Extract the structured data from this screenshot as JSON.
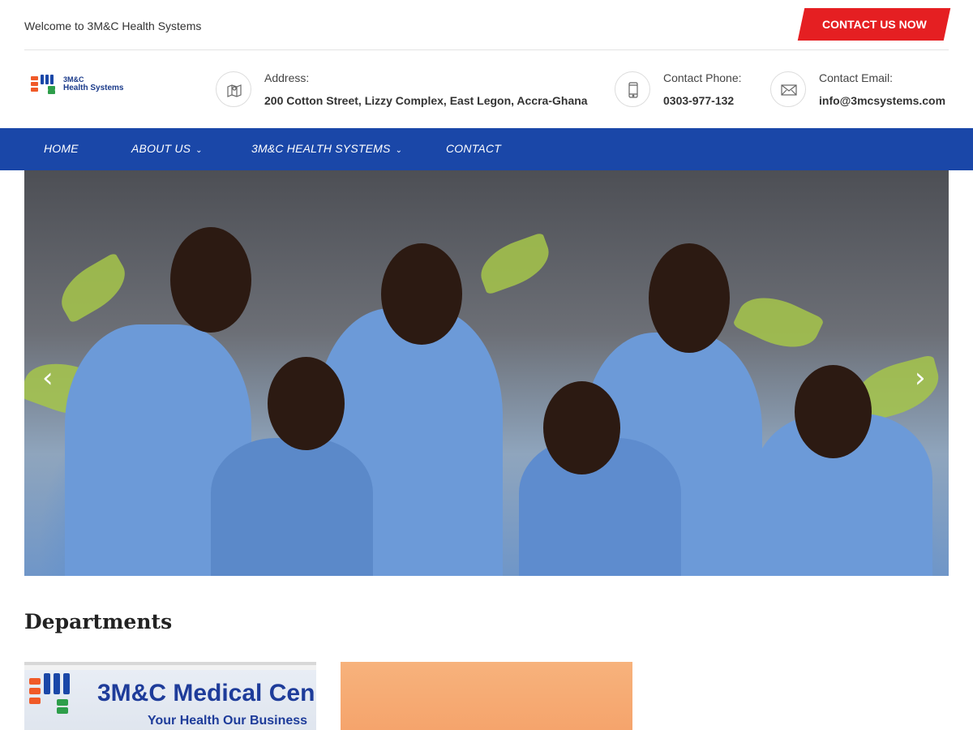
{
  "topbar": {
    "welcome": "Welcome to 3M&C Health Systems",
    "cta_label": "CONTACT US NOW"
  },
  "logo": {
    "line1": "3M&C",
    "line2": "Health Systems"
  },
  "contact_info": {
    "address_label": "Address:",
    "address_value": "200 Cotton Street, Lizzy Complex, East Legon, Accra-Ghana",
    "phone_label": "Contact Phone:",
    "phone_value": "0303-977-132",
    "email_label": "Contact Email:",
    "email_value": "info@3mcsystems.com"
  },
  "nav": {
    "items": [
      {
        "label": "HOME",
        "has_dropdown": false
      },
      {
        "label": "ABOUT US",
        "has_dropdown": true
      },
      {
        "label": "3M&C HEALTH SYSTEMS",
        "has_dropdown": true
      },
      {
        "label": "CONTACT",
        "has_dropdown": false
      }
    ]
  },
  "hero": {
    "prev_icon": "chevron-left-icon",
    "next_icon": "chevron-right-icon"
  },
  "departments": {
    "title": "Departments",
    "card1_sign_title": "3M&C Medical Cen",
    "card1_sign_subtitle": "Your Health Our Business"
  },
  "colors": {
    "brand_blue": "#1a47a8",
    "cta_red": "#e51f22"
  }
}
